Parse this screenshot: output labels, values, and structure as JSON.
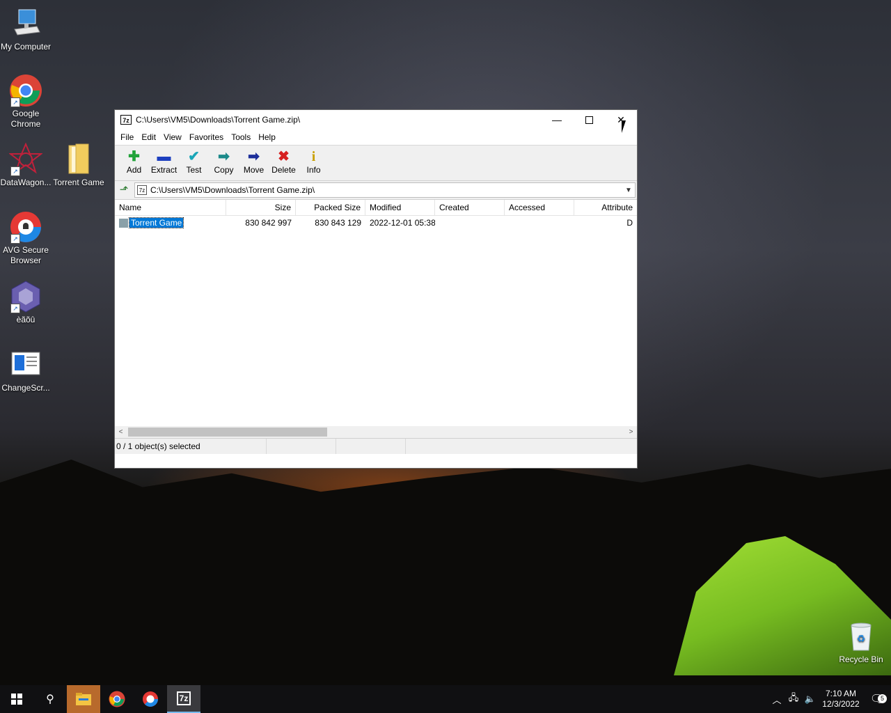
{
  "desktop": {
    "icons": [
      {
        "label": "My Computer"
      },
      {
        "label": "Google Chrome"
      },
      {
        "label": "DataWagon..."
      },
      {
        "label": "Torrent Game"
      },
      {
        "label": "AVG Secure Browser"
      },
      {
        "label": "èãõû"
      },
      {
        "label": "ChangeScr..."
      },
      {
        "label": "Recycle Bin"
      }
    ]
  },
  "window": {
    "title": "C:\\Users\\VM5\\Downloads\\Torrent Game.zip\\",
    "app_icon_text": "7z",
    "menu": [
      "File",
      "Edit",
      "View",
      "Favorites",
      "Tools",
      "Help"
    ],
    "toolbar": [
      {
        "label": "Add",
        "icon": "plus-icon",
        "color": "#22a33a"
      },
      {
        "label": "Extract",
        "icon": "minus-icon",
        "color": "#1d3fbf"
      },
      {
        "label": "Test",
        "icon": "check-icon",
        "color": "#1aa6b7"
      },
      {
        "label": "Copy",
        "icon": "copy-arrow-icon",
        "color": "#1c8a8a"
      },
      {
        "label": "Move",
        "icon": "move-arrow-icon",
        "color": "#1d2f9a"
      },
      {
        "label": "Delete",
        "icon": "x-icon",
        "color": "#d62020"
      },
      {
        "label": "Info",
        "icon": "info-icon",
        "color": "#c9a000"
      }
    ],
    "address": "C:\\Users\\VM5\\Downloads\\Torrent Game.zip\\",
    "columns": [
      "Name",
      "Size",
      "Packed Size",
      "Modified",
      "Created",
      "Accessed",
      "Attribute"
    ],
    "rows": [
      {
        "name": "Torrent Game",
        "size": "830 842 997",
        "packed": "830 843 129",
        "modified": "2022-12-01 05:38",
        "created": "",
        "accessed": "",
        "attr": "D"
      }
    ],
    "status": "0 / 1 object(s) selected"
  },
  "taskbar": {
    "time": "7:10 AM",
    "date": "12/3/2022",
    "notifications": "5",
    "accent": "#76b9ed"
  }
}
